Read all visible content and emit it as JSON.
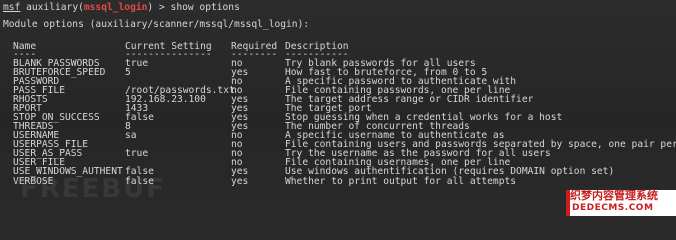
{
  "prompt": {
    "tool": "msf",
    "word": "auxiliary",
    "module": "mssql_login",
    "arrow": ">",
    "command": "show options"
  },
  "module_options_header": "Module options (auxiliary/scanner/mssql/mssql_login):",
  "table": {
    "headers": [
      "Name",
      "Current Setting",
      "Required",
      "Description"
    ],
    "separators": [
      "----",
      "---------------",
      "--------",
      "-----------"
    ],
    "rows": [
      [
        "BLANK_PASSWORDS",
        "true",
        "no",
        "Try blank passwords for all users"
      ],
      [
        "BRUTEFORCE_SPEED",
        "5",
        "yes",
        "How fast to bruteforce, from 0 to 5"
      ],
      [
        "PASSWORD",
        "",
        "no",
        "A specific password to authenticate with"
      ],
      [
        "PASS_FILE",
        "/root/passwords.txt",
        "no",
        "File containing passwords, one per line"
      ],
      [
        "RHOSTS",
        "192.168.23.100",
        "yes",
        "The target address range or CIDR identifier"
      ],
      [
        "RPORT",
        "1433",
        "yes",
        "The target port"
      ],
      [
        "STOP_ON_SUCCESS",
        "false",
        "yes",
        "Stop guessing when a credential works for a host"
      ],
      [
        "THREADS",
        "8",
        "yes",
        "The number of concurrent threads"
      ],
      [
        "USERNAME",
        "sa",
        "no",
        "A specific username to authenticate as"
      ],
      [
        "USERPASS_FILE",
        "",
        "no",
        "File containing users and passwords separated by space, one pair per line"
      ],
      [
        "USER_AS_PASS",
        "true",
        "no",
        "Try the username as the password for all users"
      ],
      [
        "USER_FILE",
        "",
        "no",
        "File containing usernames, one per line"
      ],
      [
        "USE_WINDOWS_AUTHENT",
        "false",
        "yes",
        "Use windows authentification (requires DOMAIN option set)"
      ],
      [
        "VERBOSE",
        "false",
        "yes",
        "Whether to print output for all attempts"
      ]
    ]
  },
  "watermark_text": "FREEBUF",
  "badge": {
    "top_text": "织梦内容管理系统",
    "bottom_text": "DEDECMS.COM"
  },
  "colors": {
    "background": "#2a2a2a",
    "text": "#d6d6d6",
    "module_name": "#e24a4a",
    "badge_text": "#c81e1e"
  }
}
